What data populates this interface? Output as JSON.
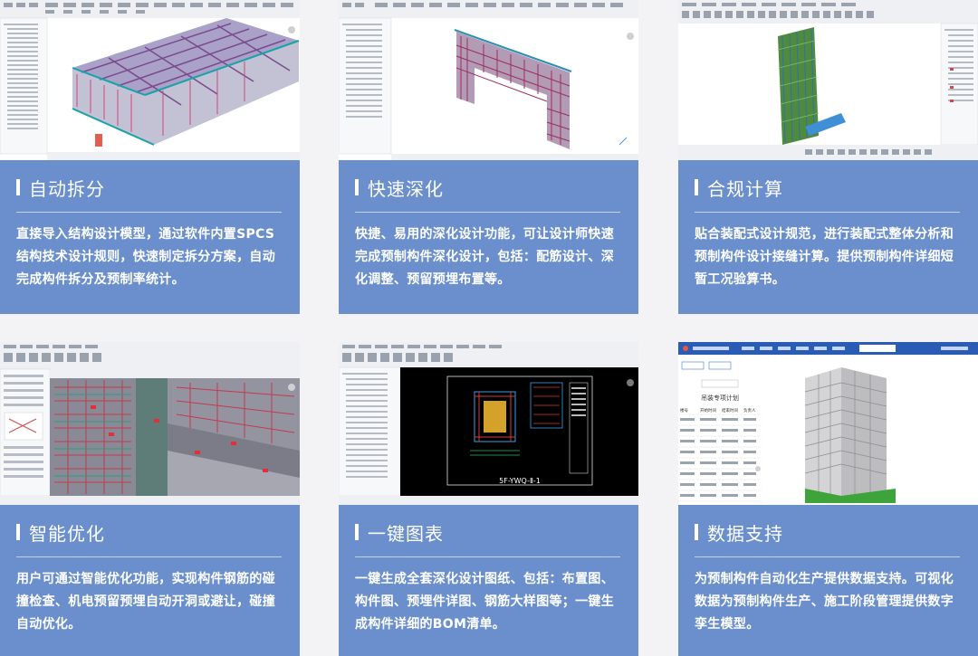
{
  "cards": [
    {
      "title": "自动拆分",
      "desc": "直接导入结构设计模型，通过软件内置SPCS结构技术设计规则，快速制定拆分方案，自动完成构件拆分及预制率统计。"
    },
    {
      "title": "快速深化",
      "desc": "快捷、易用的深化设计功能，可让设计师快速完成预制构件深化设计，包括：配筋设计、深化调整、预留预埋布置等。"
    },
    {
      "title": "合规计算",
      "desc": "贴合装配式设计规范，进行装配式整体分析和预制构件设计接缝计算。提供预制构件详细短暂工况验算书。"
    },
    {
      "title": "智能优化",
      "desc": "用户可通过智能优化功能，实现构件钢筋的碰撞检查、机电预留预埋自动开洞或避让，碰撞自动优化。"
    },
    {
      "title": "一键图表",
      "desc": "一键生成全套深化设计图纸、包括：布置图、构件图、预埋件详图、钢筋大样图等；一键生成构件详细的BOM清单。"
    },
    {
      "title": "数据支持",
      "desc": "为预制构件自动化生产提供数据支持。可视化数据为预制构件生产、施工阶段管理提供数字孪生模型。"
    }
  ],
  "screens": {
    "drawing_label": "5F-YWQ-Ⅱ-1",
    "table_title": "吊装专项计划",
    "table_headers": [
      "楼号",
      "开始时间",
      "结束时间",
      "负责人"
    ]
  }
}
